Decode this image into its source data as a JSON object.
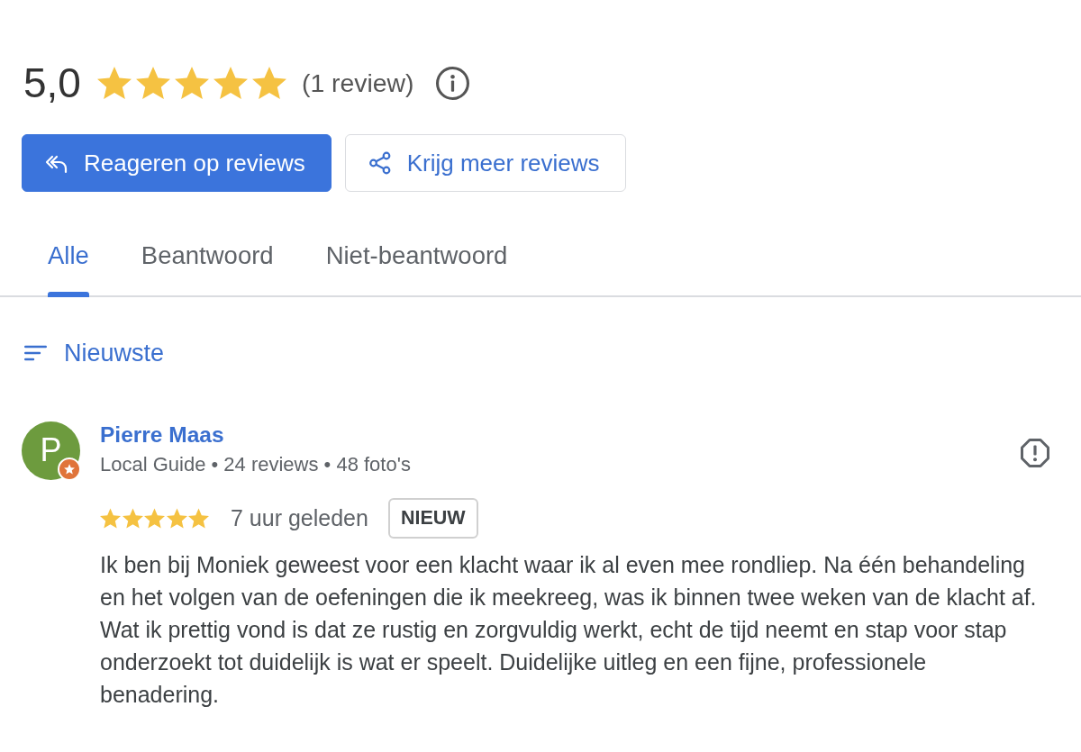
{
  "rating": {
    "score": "5,0",
    "stars": 5,
    "count": "(1 review)"
  },
  "actions": [
    {
      "label": "Reageren op reviews",
      "kind": "primary"
    },
    {
      "label": "Krijg meer reviews",
      "kind": "secondary"
    }
  ],
  "tabs": [
    {
      "label": "Alle",
      "selected": true
    },
    {
      "label": "Beantwoord",
      "selected": false
    },
    {
      "label": "Niet-beantwoord",
      "selected": false
    }
  ],
  "sort": {
    "label": "Nieuwste"
  },
  "reviews": [
    {
      "initial": "P",
      "local_guide": true,
      "author": "Pierre Maas",
      "meta": "Local Guide • 24 reviews • 48 foto's",
      "stars": 5,
      "time": "7 uur geleden",
      "badge": "NIEUW",
      "text": "Ik ben bij Moniek geweest voor een klacht waar ik al even mee rondliep. Na één behandeling en het volgen van de oefeningen die ik meekreeg, was ik binnen twee weken van de klacht af. Wat ik prettig vond is dat ze rustig en zorgvuldig werkt, echt de tijd neemt en stap voor stap onderzoekt tot duidelijk is wat er speelt. Duidelijke uitleg en een fijne, professionele benadering."
    }
  ]
}
